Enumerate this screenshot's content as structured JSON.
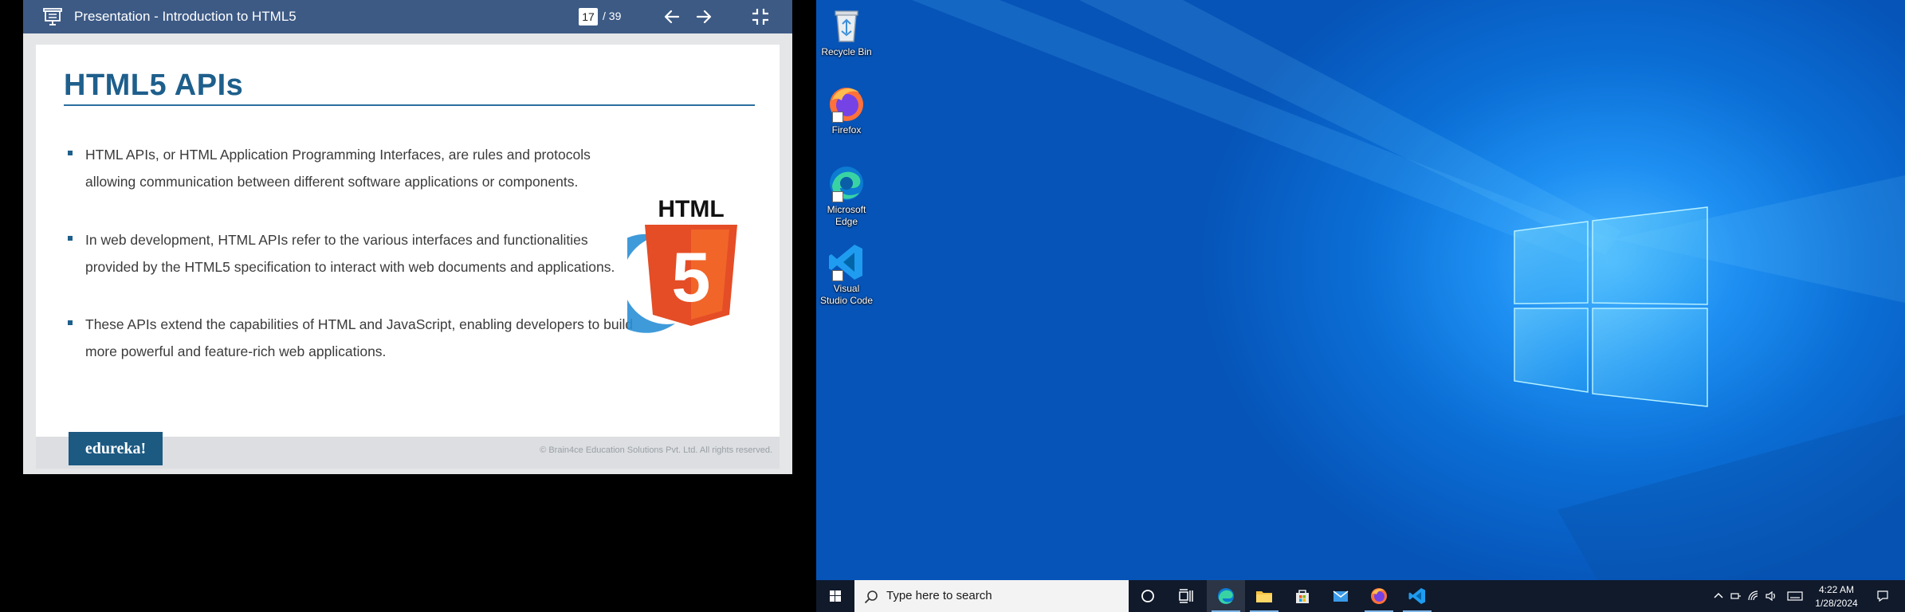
{
  "viewer": {
    "title": "Presentation - Introduction to HTML5",
    "current_page": "17",
    "total_pages": "/ 39"
  },
  "slide": {
    "title": "HTML5 APIs",
    "bullets": [
      "HTML APIs, or HTML Application Programming Interfaces, are rules and protocols allowing communication between different software applications or components.",
      "In web development, HTML APIs refer to the various interfaces and functionalities provided by the HTML5 specification to interact with web documents and applications.",
      "These APIs extend the capabilities of HTML and JavaScript, enabling developers to build more powerful and feature-rich web applications."
    ],
    "logo_text": "HTML",
    "logo_number": "5",
    "brand": "edureka!",
    "copyright": "© Brain4ce Education Solutions Pvt. Ltd. All rights reserved."
  },
  "desktop": {
    "icons": [
      {
        "label": "Recycle Bin",
        "icon": "recycle-bin-icon"
      },
      {
        "label": "Firefox",
        "icon": "firefox-icon"
      },
      {
        "label": "Microsoft Edge",
        "icon": "edge-icon"
      },
      {
        "label": "Visual Studio Code",
        "icon": "vscode-icon"
      }
    ]
  },
  "taskbar": {
    "search_placeholder": "Type here to search",
    "time": "4:22 AM",
    "date": "1/28/2024"
  },
  "colors": {
    "viewer_bar": "#3d5a85",
    "slide_accent": "#1e5f8c",
    "html5_orange": "#e44d26",
    "taskbar": "#101a2b"
  }
}
